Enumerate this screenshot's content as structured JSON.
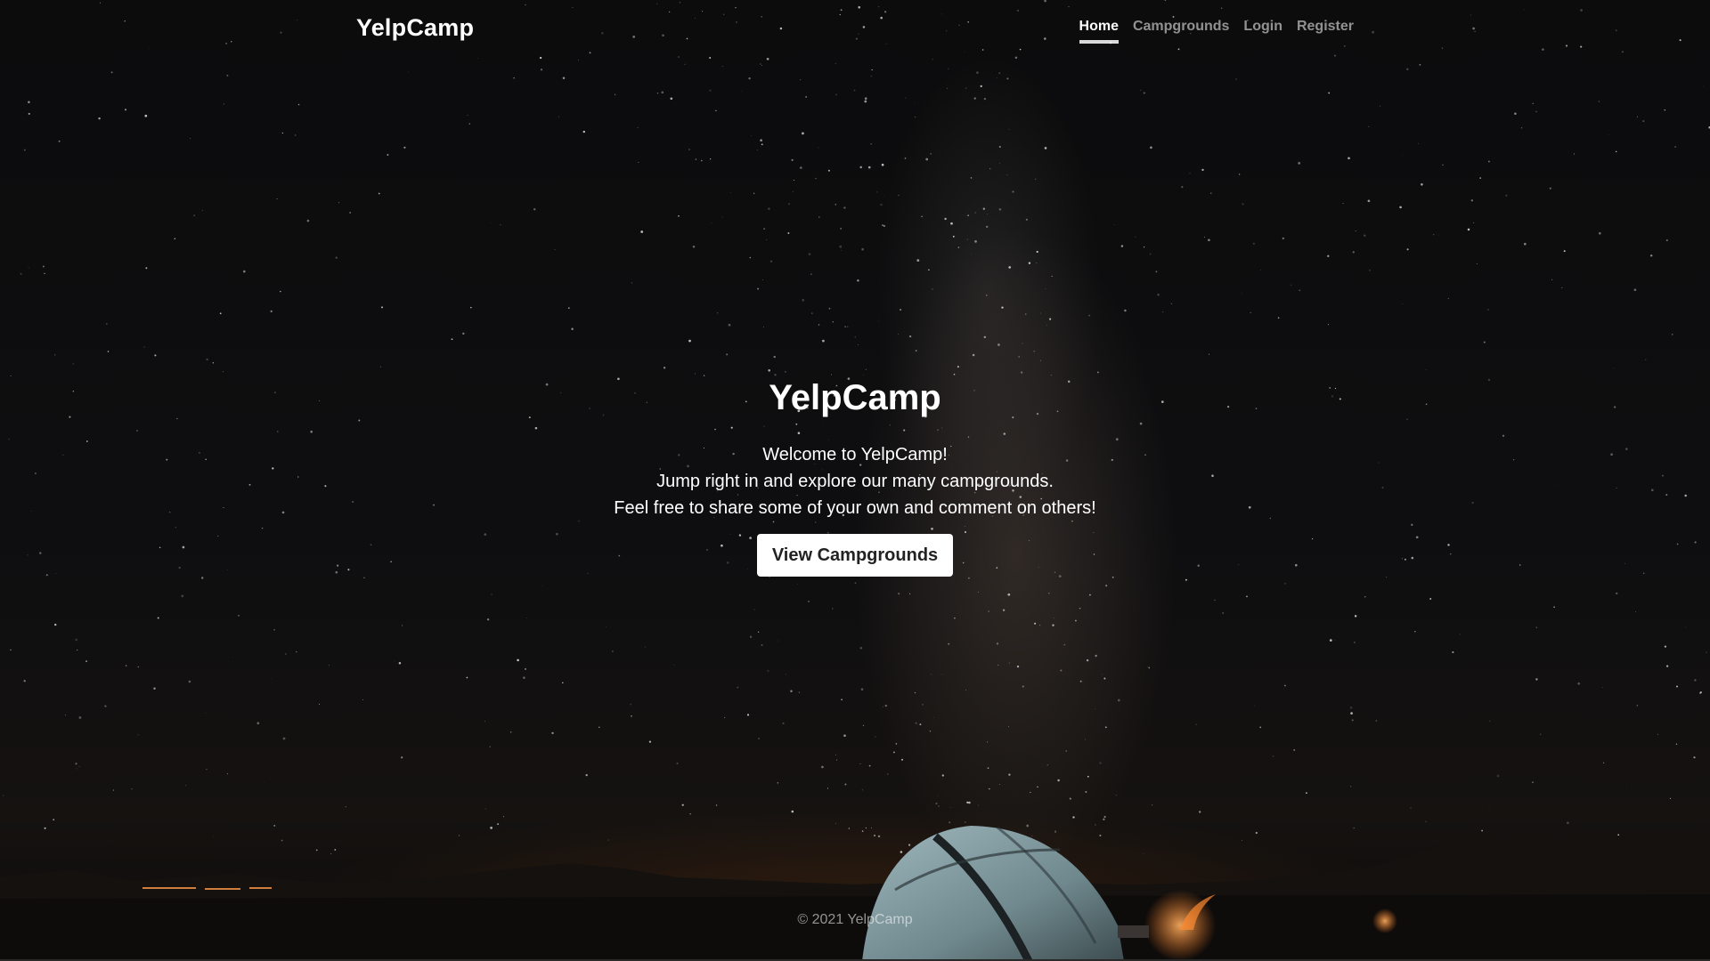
{
  "navbar": {
    "brand": "YelpCamp",
    "links": [
      {
        "label": "Home",
        "active": true
      },
      {
        "label": "Campgrounds",
        "active": false
      },
      {
        "label": "Login",
        "active": false
      },
      {
        "label": "Register",
        "active": false
      }
    ]
  },
  "hero": {
    "title": "YelpCamp",
    "lines": [
      "Welcome to YelpCamp!",
      "Jump right in and explore our many campgrounds.",
      "Feel free to share some of your own and comment on others!"
    ],
    "cta_label": "View Campgrounds"
  },
  "footer": {
    "text": "© 2021 YelpCamp"
  },
  "colors": {
    "sky": "#0c0c0d",
    "glow": "#7a3c14",
    "tent": "#7f9aa0",
    "button_bg": "#ffffff",
    "button_text": "#222222"
  }
}
